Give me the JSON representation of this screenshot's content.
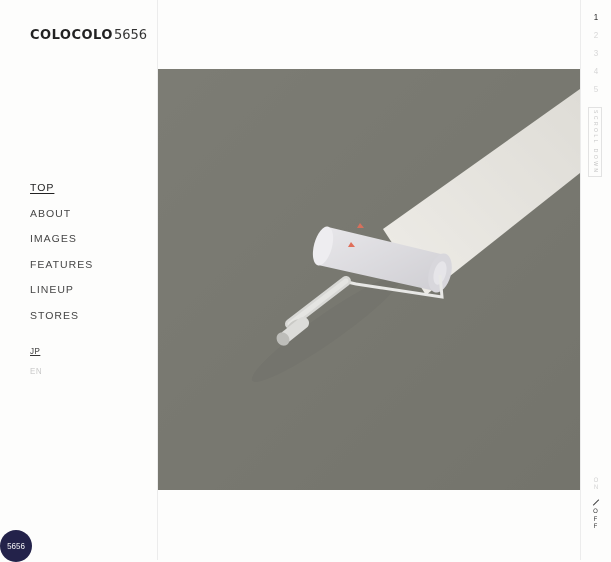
{
  "logo": {
    "brand": "COLOCOLO",
    "number": "5656"
  },
  "nav": {
    "items": [
      {
        "label": "TOP",
        "active": true
      },
      {
        "label": "ABOUT"
      },
      {
        "label": "IMAGES"
      },
      {
        "label": "FEATURES"
      },
      {
        "label": "LINEUP"
      },
      {
        "label": "STORES"
      }
    ]
  },
  "language": {
    "items": [
      {
        "label": "JP",
        "active": true
      },
      {
        "label": "EN"
      }
    ]
  },
  "hero": {
    "image": "paint-roller-on-gray-floor"
  },
  "pager": {
    "items": [
      "1",
      "2",
      "3",
      "4",
      "5"
    ],
    "active": "1"
  },
  "scroll": {
    "label": "SCROLL DOWN"
  },
  "sound": {
    "on_label": "ON",
    "off_label": "OFF"
  },
  "badge": {
    "label": "5656"
  },
  "colors": {
    "background": "#fdfdfc",
    "hero_floor": "#7a7a72",
    "paint_strip": "#e5e3de",
    "roller_accent": "#e06f5a",
    "badge": "#23224a"
  }
}
